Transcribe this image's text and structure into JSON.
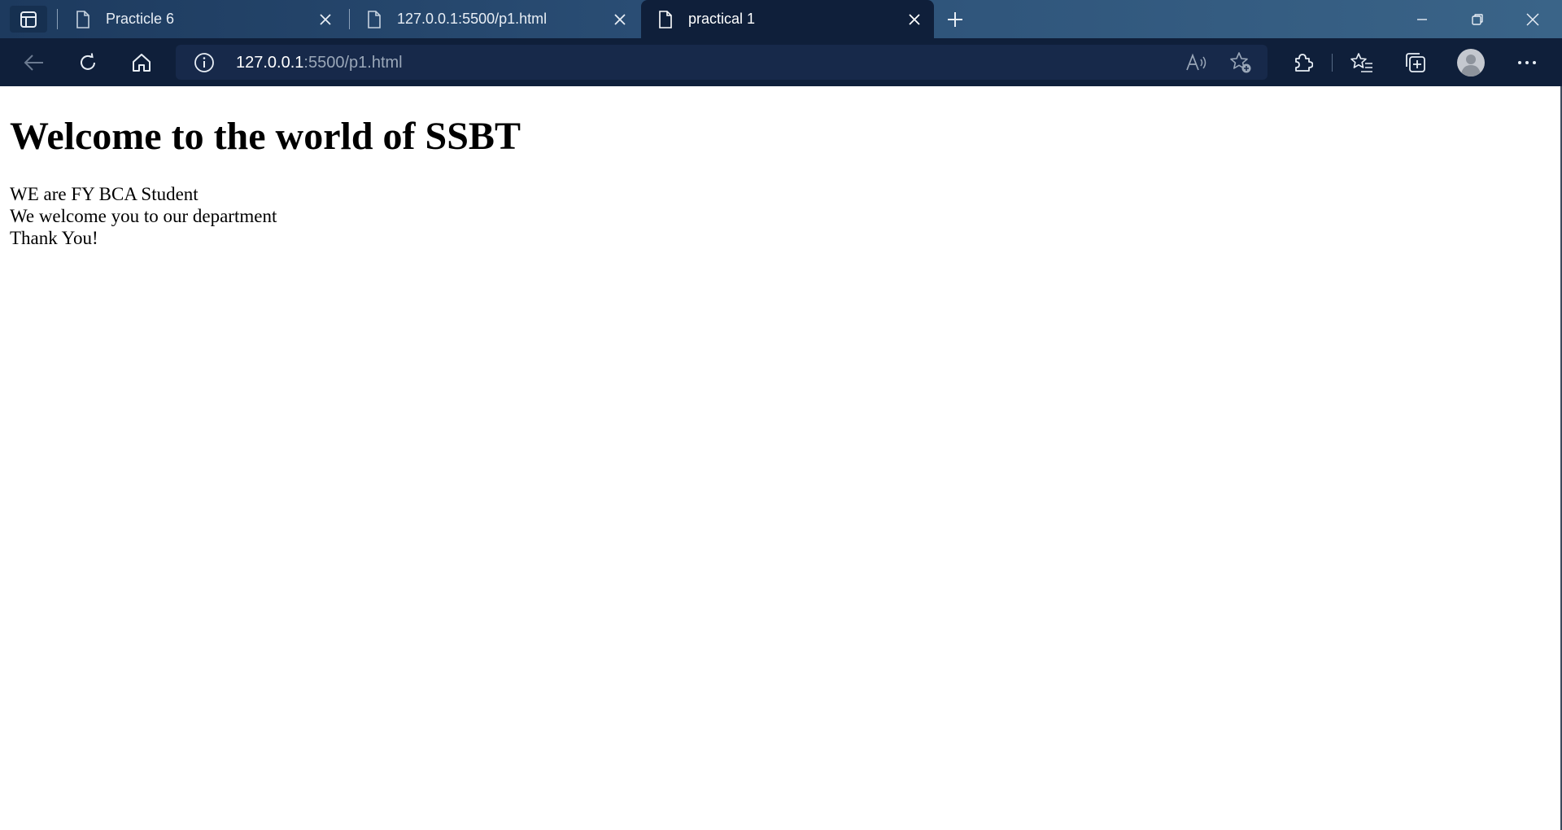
{
  "browser": {
    "tabs": [
      {
        "title": "Practicle 6",
        "active": false
      },
      {
        "title": "127.0.0.1:5500/p1.html",
        "active": false
      },
      {
        "title": "practical 1",
        "active": true
      }
    ],
    "address": {
      "host": "127.0.0.1",
      "rest": ":5500/p1.html"
    },
    "icons": {
      "tab_actions": "tab-actions-icon",
      "new_tab": "plus-icon",
      "back": "back-arrow-icon",
      "refresh": "refresh-icon",
      "home": "home-icon",
      "site_info": "info-icon",
      "read_aloud": "read-aloud-icon",
      "add_favorite": "add-favorite-icon",
      "extensions": "puzzle-icon",
      "favorites": "favorites-icon",
      "collections": "collections-icon",
      "profile": "avatar-icon",
      "menu": "more-icon"
    },
    "colors": {
      "titlebar": "#2b4f76",
      "toolbar": "#0f1f3a",
      "omnibox": "#17294a"
    }
  },
  "page": {
    "heading": "Welcome to the world of SSBT",
    "lines": [
      "WE are FY BCA Student",
      "We welcome you to our department",
      "Thank You!"
    ]
  }
}
